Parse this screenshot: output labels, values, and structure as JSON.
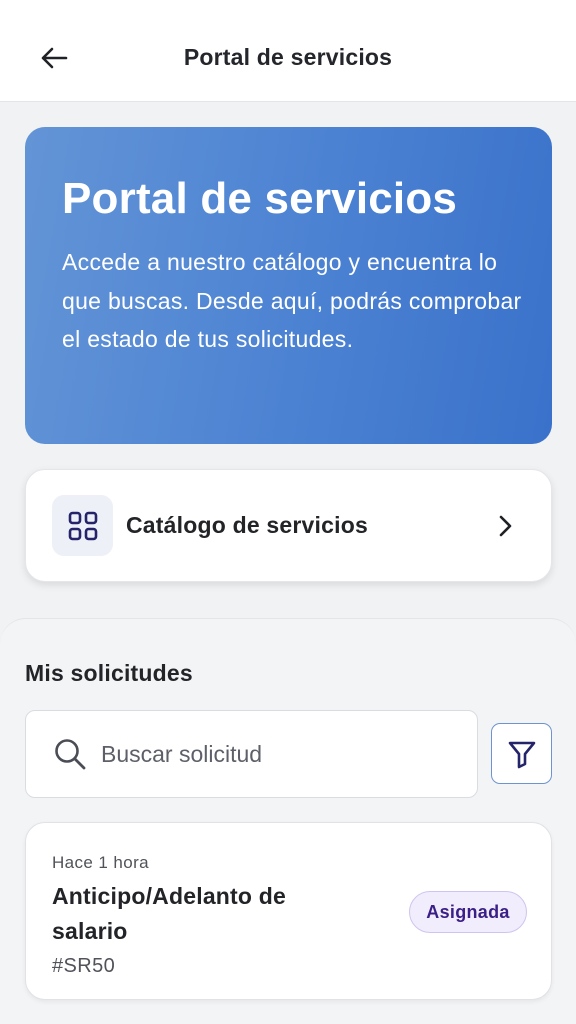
{
  "header": {
    "title": "Portal de servicios",
    "back_icon": "arrow-left-icon"
  },
  "hero": {
    "title": "Portal de servicios",
    "description": "Accede a nuestro catálogo y encuentra lo que buscas. Desde aquí, podrás comprobar el estado de tus solicitudes.",
    "gradient_start": "#6394d6",
    "gradient_end": "#3a72cb"
  },
  "catalog": {
    "label": "Catálogo de servicios",
    "icon": "grid-icon",
    "chevron": "chevron-right-icon"
  },
  "requests": {
    "section_title": "Mis solicitudes",
    "search": {
      "placeholder": "Buscar solicitud",
      "value": "",
      "icon": "search-icon"
    },
    "filter_icon": "filter-icon",
    "items": [
      {
        "time": "Hace 1 hora",
        "title": "Anticipo/Adelanto de salario",
        "id": "#SR50",
        "status": "Asignada",
        "status_color": "#3b1f86"
      }
    ]
  }
}
